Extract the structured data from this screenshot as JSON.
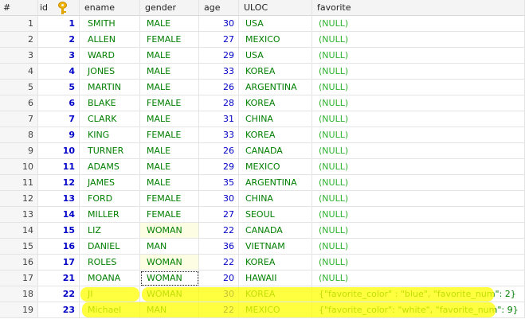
{
  "columns": {
    "rownum": "#",
    "id": "id",
    "ename": "ename",
    "gender": "gender",
    "age": "age",
    "uloc": "ULOC",
    "favorite": "favorite"
  },
  "rows": [
    {
      "n": "1",
      "id": "1",
      "ename": "SMITH",
      "gender": "MALE",
      "age": "30",
      "uloc": "USA",
      "favorite": "(NULL)"
    },
    {
      "n": "2",
      "id": "2",
      "ename": "ALLEN",
      "gender": "FEMALE",
      "age": "27",
      "uloc": "MEXICO",
      "favorite": "(NULL)"
    },
    {
      "n": "3",
      "id": "3",
      "ename": "WARD",
      "gender": "MALE",
      "age": "29",
      "uloc": "USA",
      "favorite": "(NULL)"
    },
    {
      "n": "4",
      "id": "4",
      "ename": "JONES",
      "gender": "MALE",
      "age": "33",
      "uloc": "KOREA",
      "favorite": "(NULL)"
    },
    {
      "n": "5",
      "id": "5",
      "ename": "MARTIN",
      "gender": "MALE",
      "age": "26",
      "uloc": "ARGENTINA",
      "favorite": "(NULL)"
    },
    {
      "n": "6",
      "id": "6",
      "ename": "BLAKE",
      "gender": "FEMALE",
      "age": "28",
      "uloc": "KOREA",
      "favorite": "(NULL)"
    },
    {
      "n": "7",
      "id": "7",
      "ename": "CLARK",
      "gender": "MALE",
      "age": "31",
      "uloc": "CHINA",
      "favorite": "(NULL)"
    },
    {
      "n": "8",
      "id": "9",
      "ename": "KING",
      "gender": "FEMALE",
      "age": "33",
      "uloc": "KOREA",
      "favorite": "(NULL)"
    },
    {
      "n": "9",
      "id": "10",
      "ename": "TURNER",
      "gender": "MALE",
      "age": "26",
      "uloc": "CANADA",
      "favorite": "(NULL)"
    },
    {
      "n": "10",
      "id": "11",
      "ename": "ADAMS",
      "gender": "MALE",
      "age": "29",
      "uloc": "MEXICO",
      "favorite": "(NULL)"
    },
    {
      "n": "11",
      "id": "12",
      "ename": "JAMES",
      "gender": "MALE",
      "age": "35",
      "uloc": "ARGENTINA",
      "favorite": "(NULL)"
    },
    {
      "n": "12",
      "id": "13",
      "ename": "FORD",
      "gender": "FEMALE",
      "age": "30",
      "uloc": "CHINA",
      "favorite": "(NULL)"
    },
    {
      "n": "13",
      "id": "14",
      "ename": "MILLER",
      "gender": "FEMALE",
      "age": "27",
      "uloc": "SEOUL",
      "favorite": "(NULL)"
    },
    {
      "n": "14",
      "id": "15",
      "ename": "LIZ",
      "gender": "WOMAN",
      "age": "22",
      "uloc": "CANADA",
      "favorite": "(NULL)"
    },
    {
      "n": "15",
      "id": "16",
      "ename": "DANIEL",
      "gender": "MAN",
      "age": "36",
      "uloc": "VIETNAM",
      "favorite": "(NULL)"
    },
    {
      "n": "16",
      "id": "17",
      "ename": "ROLES",
      "gender": "WOMAN",
      "age": "22",
      "uloc": "KOREA",
      "favorite": "(NULL)"
    },
    {
      "n": "17",
      "id": "21",
      "ename": "MOANA",
      "gender": "WOMAN",
      "age": "20",
      "uloc": "HAWAII",
      "favorite": "(NULL)"
    },
    {
      "n": "18",
      "id": "22",
      "ename": "JI",
      "gender": "WOMAN",
      "age": "30",
      "uloc": "KOREA",
      "favorite": "{\"favorite_color\" : \"blue\", \"favorite_num\": 2}"
    },
    {
      "n": "19",
      "id": "23",
      "ename": "Michael",
      "gender": "MAN",
      "age": "22",
      "uloc": "MEXICO",
      "favorite": "{\"favorite_color\": \"white\", \"favorite_num\": 9}"
    }
  ],
  "icons": {
    "primary_key": "key-icon"
  },
  "colors": {
    "number_text": "#0000c8",
    "string_text": "#007f00",
    "null_text": "#2fb22f",
    "highlight": "#ffff00",
    "edited_cell_bg": "#fdfde4"
  }
}
